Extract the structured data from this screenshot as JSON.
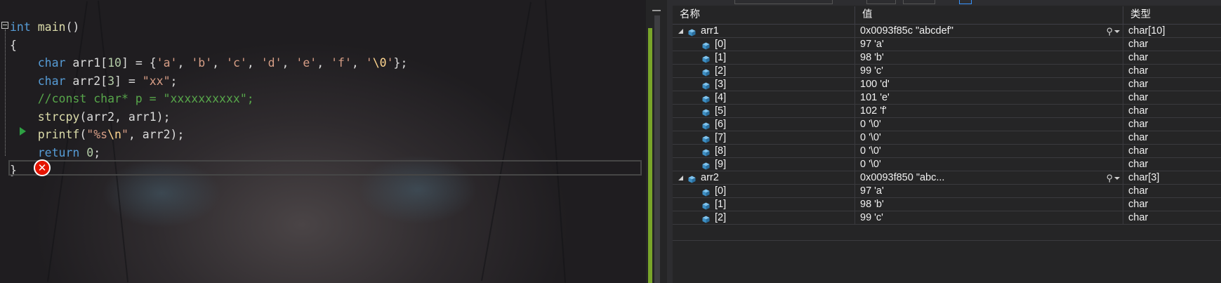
{
  "editor": {
    "code_lines": [
      [
        {
          "t": "int",
          "c": "kw"
        },
        {
          "t": " ",
          "c": "tx"
        },
        {
          "t": "main",
          "c": "fn"
        },
        {
          "t": "()",
          "c": "pn"
        }
      ],
      [
        {
          "t": "{",
          "c": "pn"
        }
      ],
      [
        {
          "t": "    ",
          "c": "tx"
        },
        {
          "t": "char",
          "c": "kw"
        },
        {
          "t": " arr1[",
          "c": "tx"
        },
        {
          "t": "10",
          "c": "num"
        },
        {
          "t": "] = {",
          "c": "tx"
        },
        {
          "t": "'a'",
          "c": "str"
        },
        {
          "t": ", ",
          "c": "tx"
        },
        {
          "t": "'b'",
          "c": "str"
        },
        {
          "t": ", ",
          "c": "tx"
        },
        {
          "t": "'c'",
          "c": "str"
        },
        {
          "t": ", ",
          "c": "tx"
        },
        {
          "t": "'d'",
          "c": "str"
        },
        {
          "t": ", ",
          "c": "tx"
        },
        {
          "t": "'e'",
          "c": "str"
        },
        {
          "t": ", ",
          "c": "tx"
        },
        {
          "t": "'f'",
          "c": "str"
        },
        {
          "t": ", ",
          "c": "tx"
        },
        {
          "t": "'",
          "c": "str"
        },
        {
          "t": "\\0",
          "c": "esc"
        },
        {
          "t": "'",
          "c": "str"
        },
        {
          "t": "};",
          "c": "tx"
        }
      ],
      [
        {
          "t": "    ",
          "c": "tx"
        },
        {
          "t": "char",
          "c": "kw"
        },
        {
          "t": " arr2[",
          "c": "tx"
        },
        {
          "t": "3",
          "c": "num"
        },
        {
          "t": "] = ",
          "c": "tx"
        },
        {
          "t": "\"xx\"",
          "c": "str"
        },
        {
          "t": ";",
          "c": "tx"
        }
      ],
      [
        {
          "t": "    //const char* p = \"xxxxxxxxxx\";",
          "c": "cm"
        }
      ],
      [
        {
          "t": "    ",
          "c": "tx"
        },
        {
          "t": "strcpy",
          "c": "fn"
        },
        {
          "t": "(arr2, arr1);",
          "c": "tx"
        }
      ],
      [
        {
          "t": "    ",
          "c": "tx"
        },
        {
          "t": "printf",
          "c": "fn"
        },
        {
          "t": "(",
          "c": "tx"
        },
        {
          "t": "\"%s",
          "c": "str"
        },
        {
          "t": "\\n",
          "c": "esc"
        },
        {
          "t": "\"",
          "c": "str"
        },
        {
          "t": ", arr2);",
          "c": "tx"
        }
      ],
      [
        {
          "t": "    ",
          "c": "tx"
        },
        {
          "t": "return",
          "c": "kw"
        },
        {
          "t": " ",
          "c": "tx"
        },
        {
          "t": "0",
          "c": "num"
        },
        {
          "t": ";",
          "c": "tx"
        }
      ],
      [
        {
          "t": "}",
          "c": "pn"
        }
      ]
    ],
    "error_icon": "error-x-icon",
    "next_statement_icon": "next-statement-arrow-icon",
    "colors": {
      "keyword": "#569cd6",
      "function": "#dcdcaa",
      "string": "#d69d85",
      "escape": "#ffd68f",
      "comment": "#57a64a",
      "number": "#b5cea8",
      "error": "#e51400"
    }
  },
  "watch": {
    "headers": {
      "name": "名称",
      "value": "值",
      "type": "类型"
    },
    "rows": [
      {
        "level": 0,
        "expanded": true,
        "name": "arr1",
        "value": "0x0093f85c \"abcdef\"",
        "type": "char[10]",
        "has_magnifier": true
      },
      {
        "level": 1,
        "name": "[0]",
        "value": "97 'a'",
        "type": "char"
      },
      {
        "level": 1,
        "name": "[1]",
        "value": "98 'b'",
        "type": "char"
      },
      {
        "level": 1,
        "name": "[2]",
        "value": "99 'c'",
        "type": "char"
      },
      {
        "level": 1,
        "name": "[3]",
        "value": "100 'd'",
        "type": "char"
      },
      {
        "level": 1,
        "name": "[4]",
        "value": "101 'e'",
        "type": "char"
      },
      {
        "level": 1,
        "name": "[5]",
        "value": "102 'f'",
        "type": "char"
      },
      {
        "level": 1,
        "name": "[6]",
        "value": "0 '\\0'",
        "type": "char"
      },
      {
        "level": 1,
        "name": "[7]",
        "value": "0 '\\0'",
        "type": "char"
      },
      {
        "level": 1,
        "name": "[8]",
        "value": "0 '\\0'",
        "type": "char"
      },
      {
        "level": 1,
        "name": "[9]",
        "value": "0 '\\0'",
        "type": "char"
      },
      {
        "level": 0,
        "expanded": true,
        "name": "arr2",
        "value": "0x0093f850 \"abc...",
        "type": "char[3]",
        "has_magnifier": true
      },
      {
        "level": 1,
        "name": "[0]",
        "value": "97 'a'",
        "type": "char"
      },
      {
        "level": 1,
        "name": "[1]",
        "value": "98 'b'",
        "type": "char"
      },
      {
        "level": 1,
        "name": "[2]",
        "value": "99 'c'",
        "type": "char"
      }
    ],
    "icons": {
      "variable": "variable-cube-icon",
      "magnifier": "magnifier-icon",
      "expander": "expand-triangle-icon"
    },
    "colors": {
      "cube": "#4ea6dc"
    }
  }
}
